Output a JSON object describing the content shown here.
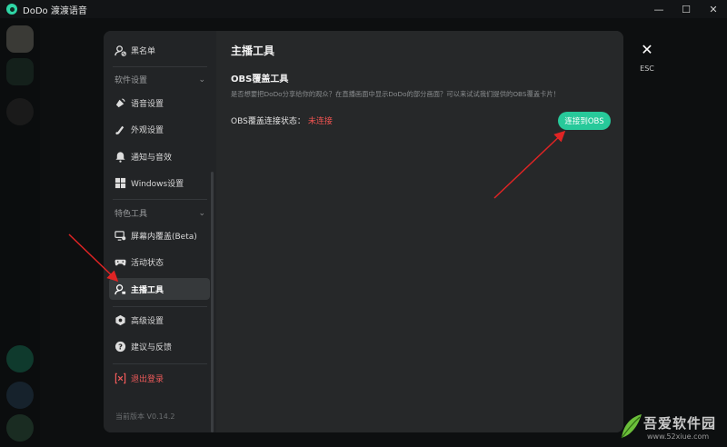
{
  "window": {
    "title": "DoDo 渡渡语音",
    "controls": [
      "—",
      "☐",
      "✕"
    ]
  },
  "sidebar": {
    "items": [
      {
        "label": "黑名单",
        "icon": "blacklist-icon"
      },
      {
        "label": "语音设置",
        "icon": "voice-icon"
      },
      {
        "label": "外观设置",
        "icon": "appearance-icon"
      },
      {
        "label": "通知与音效",
        "icon": "bell-icon"
      },
      {
        "label": "Windows设置",
        "icon": "windows-icon"
      },
      {
        "label": "屏幕内覆盖(Beta)",
        "icon": "overlay-icon"
      },
      {
        "label": "活动状态",
        "icon": "gamepad-icon"
      },
      {
        "label": "主播工具",
        "icon": "streamer-icon"
      },
      {
        "label": "高级设置",
        "icon": "advanced-icon"
      },
      {
        "label": "建议与反馈",
        "icon": "help-icon"
      },
      {
        "label": "退出登录",
        "icon": "logout-icon"
      }
    ],
    "sections": {
      "software": "软件设置",
      "features": "特色工具"
    },
    "version": "当前版本 V0.14.2",
    "active_item": "主播工具"
  },
  "main": {
    "title": "主播工具",
    "obs_section_title": "OBS覆盖工具",
    "obs_description": "是否想要把DoDo分享给你的观众？在直播画面中显示DoDo的部分画面？可以来试试我们提供的OBS覆盖卡片！",
    "status_label": "OBS覆盖连接状态：",
    "status_value": "未连接",
    "connect_button": "连接到OBS"
  },
  "esc": {
    "icon": "close-icon",
    "label": "ESC"
  },
  "watermark": {
    "title": "吾爱软件园",
    "url": "www.52xiue.com"
  },
  "colors": {
    "accent": "#27c99a",
    "danger": "#ef5350",
    "modal_bg": "#262829",
    "sidebar_bg": "#222426",
    "annotation_arrow": "#e02424"
  }
}
